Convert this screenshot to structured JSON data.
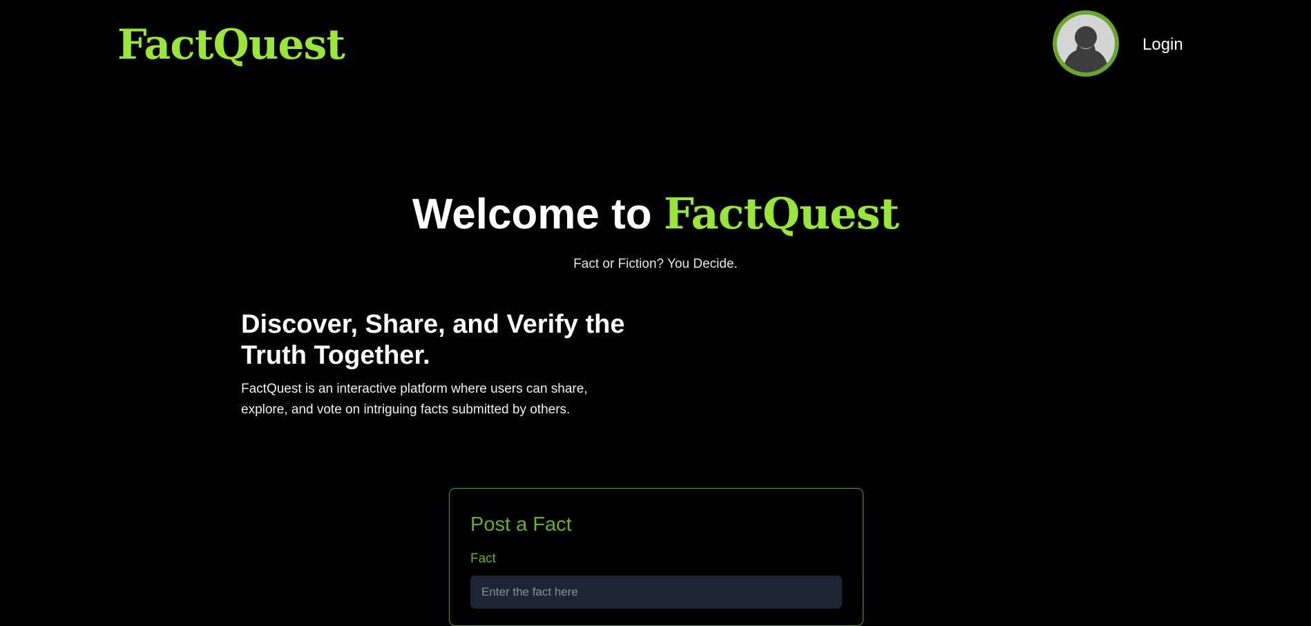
{
  "header": {
    "logo": "FactQuest",
    "login_label": "Login"
  },
  "hero": {
    "title_prefix": "Welcome to ",
    "title_brand": "FactQuest",
    "tagline": "Fact or Fiction? You Decide."
  },
  "intro": {
    "heading": "Discover, Share, and Verify the Truth Together.",
    "text": "FactQuest is an interactive platform where users can share, explore, and vote on intriguing facts submitted by others."
  },
  "post_form": {
    "title": "Post a Fact",
    "fact_label": "Fact",
    "fact_placeholder": "Enter the fact here"
  },
  "colors": {
    "background": "#000000",
    "brand_green": "#9ae53a",
    "accent_green": "#6cae2c",
    "input_bg": "#1f2633"
  },
  "icons": {
    "avatar": "user-silhouette-icon"
  }
}
